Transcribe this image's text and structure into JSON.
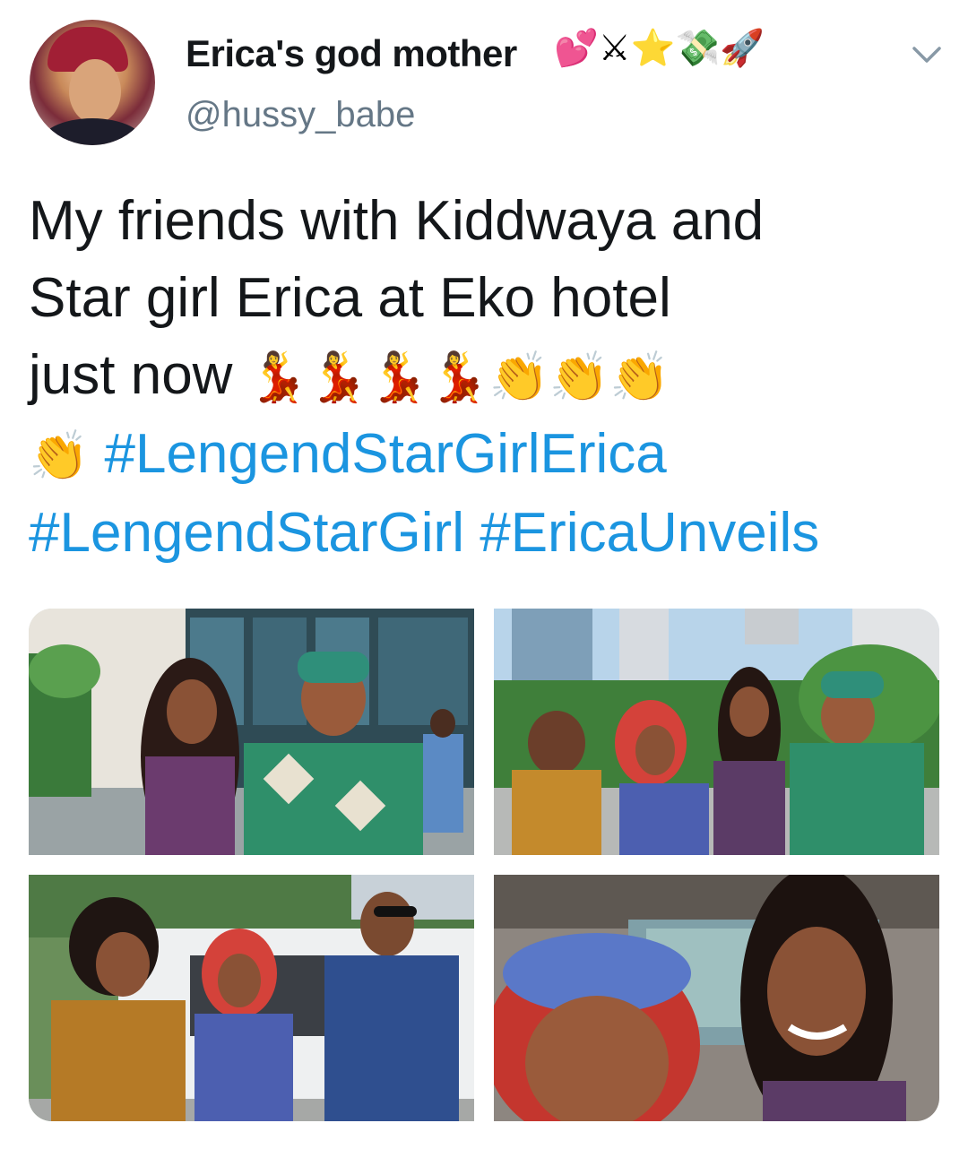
{
  "tweet": {
    "display_name": "Erica's god mother",
    "name_emojis": "💕⚔⭐💸🚀",
    "handle": "@hussy_babe",
    "text_line1": "My friends with Kiddwaya and",
    "text_line2": "Star girl Erica at Eko hotel",
    "text_line3": "just now",
    "emojis_line3": "💃💃💃💃👏👏👏",
    "emojis_line4": "👏",
    "hashtag1": "#LengendStarGirlErica",
    "hashtag2": "#LengendStarGirl",
    "hashtag3": "#EricaUnveils"
  },
  "icons": {
    "avatar": "profile-photo",
    "menu": "chevron-down-icon"
  },
  "colors": {
    "text": "#14171a",
    "secondary": "#657786",
    "link": "#1b95e0"
  }
}
